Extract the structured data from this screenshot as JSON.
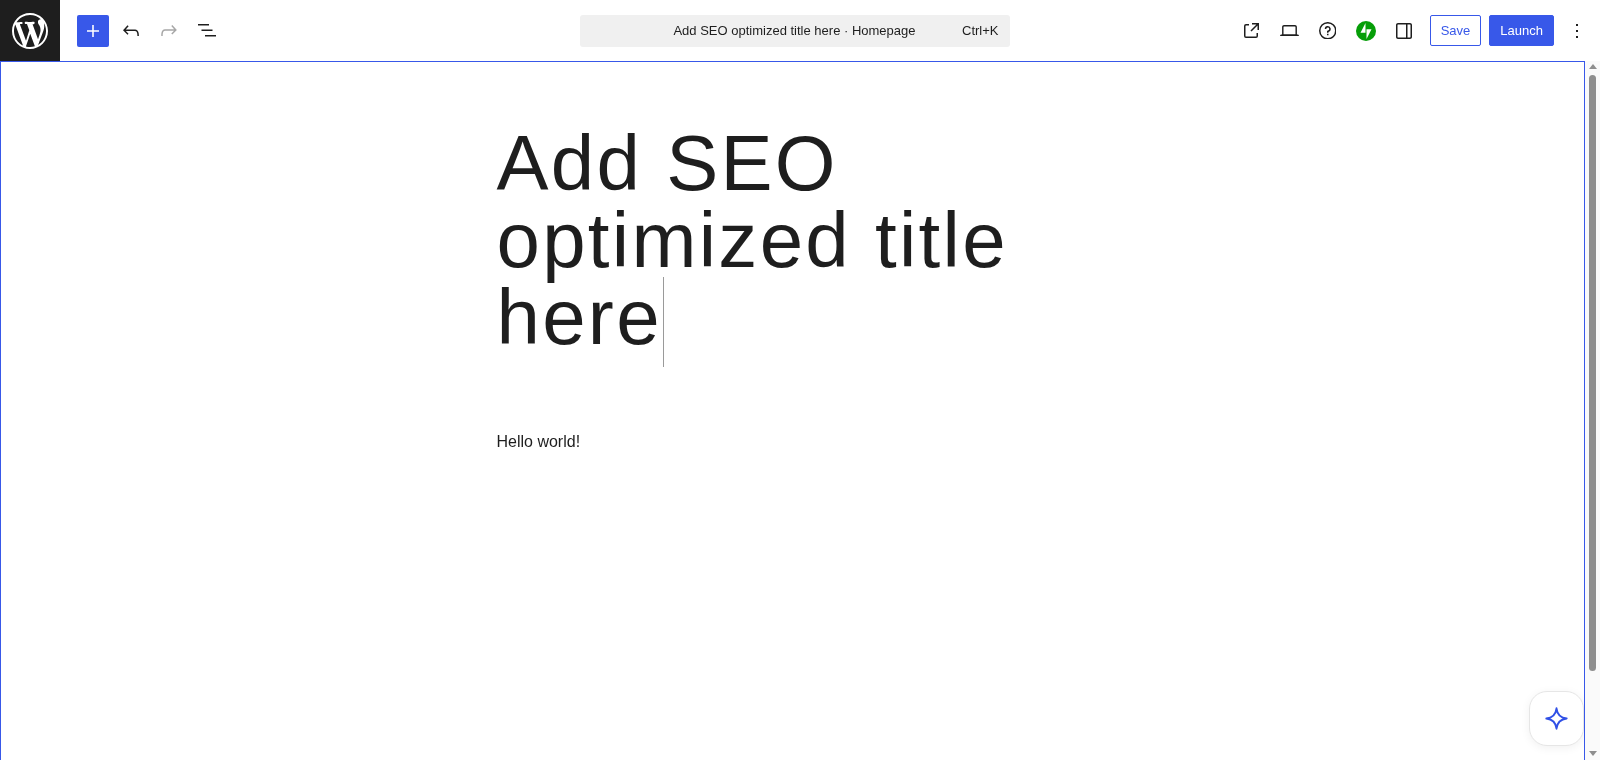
{
  "toolbar": {
    "left_tools": [
      {
        "kind": "inserter",
        "disabled": false
      },
      {
        "kind": "undo",
        "disabled": false
      },
      {
        "kind": "redo",
        "disabled": true
      },
      {
        "kind": "list-view",
        "disabled": false
      }
    ],
    "command_bar": {
      "title": "Add SEO optimized title here · Homepage",
      "shortcut": "Ctrl+K"
    },
    "right_tools": [
      {
        "kind": "view"
      },
      {
        "kind": "preview"
      },
      {
        "kind": "help"
      },
      {
        "kind": "jetpack"
      },
      {
        "kind": "settings"
      }
    ],
    "save_button": {
      "label": "Save"
    },
    "launch_button": {
      "label": "Launch"
    }
  },
  "editor": {
    "title": {
      "text": "Add SEO optimized title here",
      "focused": true
    },
    "blocks": [
      {
        "kind": "paragraph",
        "text": "Hello world!"
      }
    ]
  }
}
